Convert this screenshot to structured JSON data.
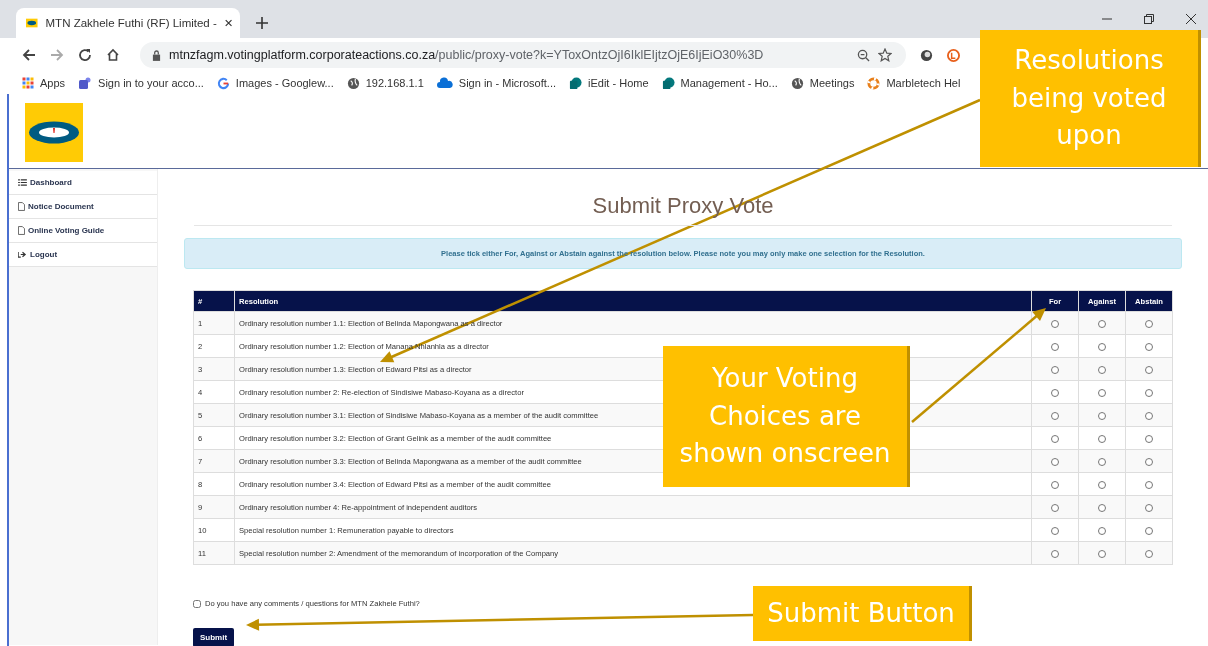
{
  "browser": {
    "tab": {
      "title": "MTN Zakhele Futhi (RF) Limited -"
    },
    "address": {
      "host": "mtnzfagm.votingplatform.corporateactions.co.za",
      "path": "/public/proxy-vote?k=YToxOntzOjI6IklEIjtzOjE6IjEiO30%3D"
    },
    "bookmarks": [
      {
        "kind": "apps",
        "label": "Apps"
      },
      {
        "kind": "teams",
        "label": "Sign in to your acco..."
      },
      {
        "kind": "google",
        "label": "Images - Googlew..."
      },
      {
        "kind": "globe",
        "label": "192.168.1.1"
      },
      {
        "kind": "cloud",
        "label": "Sign in - Microsoft..."
      },
      {
        "kind": "sharepoint",
        "label": "iEdit - Home"
      },
      {
        "kind": "sharepoint",
        "label": "Management - Ho..."
      },
      {
        "kind": "globe",
        "label": "Meetings"
      },
      {
        "kind": "lifebuoy",
        "label": "Marbletech Hel"
      }
    ]
  },
  "sidebar": {
    "items": [
      {
        "kind": "list",
        "label": "Dashboard"
      },
      {
        "kind": "document",
        "label": "Notice Document"
      },
      {
        "kind": "document",
        "label": "Online Voting Guide"
      },
      {
        "kind": "logout",
        "label": "Logout"
      }
    ]
  },
  "page": {
    "title": "Submit Proxy Vote",
    "notice": "Please tick either For, Against or Abstain against the resolution below. Please note you may only make one selection for the Resolution.",
    "table": {
      "columns": [
        "#",
        "Resolution",
        "For",
        "Against",
        "Abstain"
      ],
      "rows": [
        {
          "number": "1",
          "resolution": "Ordinary resolution number 1.1: Election of Belinda Mapongwana as a director",
          "choices": [
            {
              "checked": false
            },
            {
              "checked": false
            },
            {
              "checked": false
            }
          ]
        },
        {
          "number": "2",
          "resolution": "Ordinary resolution number 1.2: Election of Manana Nhlanhla as a director",
          "choices": [
            {
              "checked": false
            },
            {
              "checked": false
            },
            {
              "checked": false
            }
          ]
        },
        {
          "number": "3",
          "resolution": "Ordinary resolution number 1.3: Election of Edward Pitsi as a director",
          "choices": [
            {
              "checked": false
            },
            {
              "checked": false
            },
            {
              "checked": false
            }
          ]
        },
        {
          "number": "4",
          "resolution": "Ordinary resolution number 2: Re-election of Sindisiwe Mabaso-Koyana as a director",
          "choices": [
            {
              "checked": false
            },
            {
              "checked": false
            },
            {
              "checked": false
            }
          ]
        },
        {
          "number": "5",
          "resolution": "Ordinary resolution number 3.1: Election of Sindisiwe Mabaso-Koyana as a member of the audit committee",
          "choices": [
            {
              "checked": false
            },
            {
              "checked": false
            },
            {
              "checked": false
            }
          ]
        },
        {
          "number": "6",
          "resolution": "Ordinary resolution number 3.2: Election of Grant Gelink as a member of the audit committee",
          "choices": [
            {
              "checked": false
            },
            {
              "checked": false
            },
            {
              "checked": false
            }
          ]
        },
        {
          "number": "7",
          "resolution": "Ordinary resolution number 3.3: Election of Belinda Mapongwana as a member of the audit committee",
          "choices": [
            {
              "checked": false
            },
            {
              "checked": false
            },
            {
              "checked": false
            }
          ]
        },
        {
          "number": "8",
          "resolution": "Ordinary resolution number 3.4: Election of Edward Pitsi as a member of the audit committee",
          "choices": [
            {
              "checked": false
            },
            {
              "checked": false
            },
            {
              "checked": false
            }
          ]
        },
        {
          "number": "9",
          "resolution": "Ordinary resolution number 4: Re-appointment of independent auditors",
          "choices": [
            {
              "checked": false
            },
            {
              "checked": false
            },
            {
              "checked": false
            }
          ]
        },
        {
          "number": "10",
          "resolution": "Special resolution number 1: Remuneration payable to directors",
          "choices": [
            {
              "checked": false
            },
            {
              "checked": false
            },
            {
              "checked": false
            }
          ]
        },
        {
          "number": "11",
          "resolution": "Special resolution number 2: Amendment of the memorandum of incorporation of the Company",
          "choices": [
            {
              "checked": false
            },
            {
              "checked": false
            },
            {
              "checked": false
            }
          ]
        }
      ]
    },
    "comments": {
      "label": "Do you have any comments / questions for MTN Zakhele Futhi?",
      "checked": false
    },
    "submit": "Submit"
  },
  "callouts": [
    {
      "text": "Resolutions being voted upon"
    },
    {
      "text": "Your Voting Choices are shown onscreen"
    },
    {
      "text": "Submit Button"
    }
  ]
}
